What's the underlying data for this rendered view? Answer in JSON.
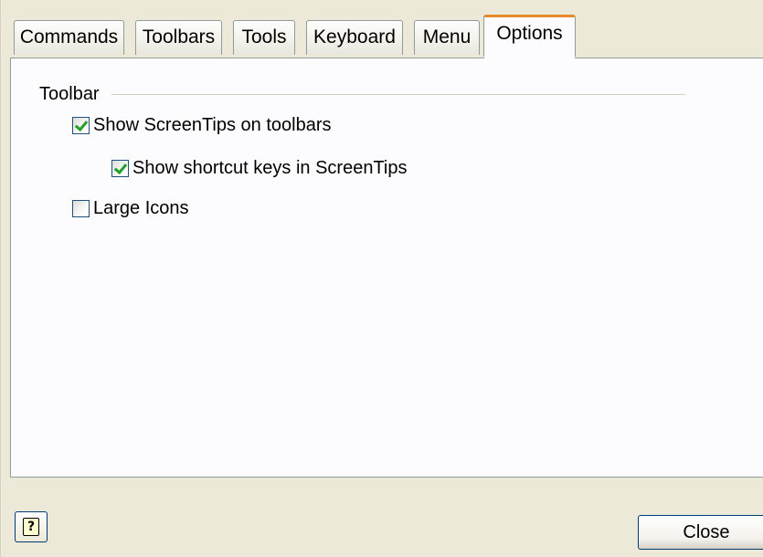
{
  "tabs": [
    {
      "label": "Commands",
      "active": false
    },
    {
      "label": "Toolbars",
      "active": false
    },
    {
      "label": "Tools",
      "active": false
    },
    {
      "label": "Keyboard",
      "active": false
    },
    {
      "label": "Menu",
      "active": false
    },
    {
      "label": "Options",
      "active": true
    }
  ],
  "toolbar_group": {
    "title": "Toolbar",
    "show_screentips": {
      "label": "Show ScreenTips on toolbars",
      "checked": true
    },
    "show_shortcut_keys": {
      "label": "Show shortcut keys in ScreenTips",
      "checked": true
    },
    "large_icons": {
      "label": "Large Icons",
      "checked": false
    }
  },
  "buttons": {
    "help_glyph": "?",
    "close_label": "Close"
  },
  "colors": {
    "active_tab_accent": "#e68b2c",
    "checkmark": "#21a121",
    "dialog_background": "#ece9d8"
  }
}
